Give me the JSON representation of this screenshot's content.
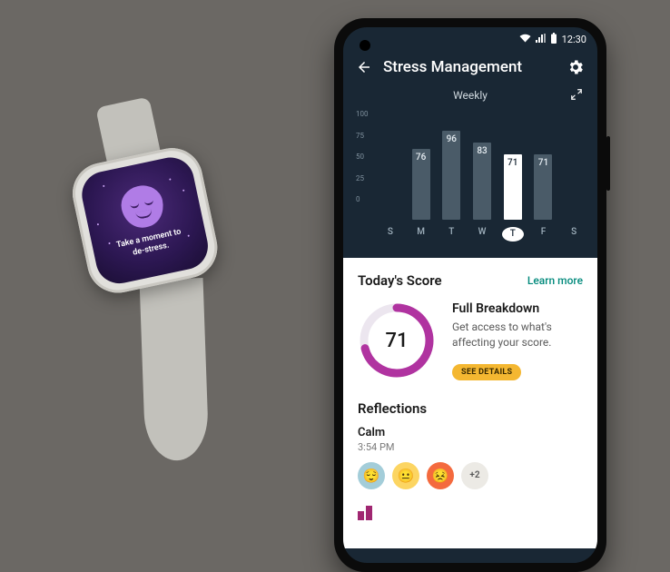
{
  "watch": {
    "message_line1": "Take a moment to",
    "message_line2": "de-stress."
  },
  "status": {
    "time": "12:30"
  },
  "appbar": {
    "title": "Stress Management"
  },
  "chart_data": {
    "type": "bar",
    "period_label": "Weekly",
    "categories": [
      "S",
      "M",
      "T",
      "W",
      "T",
      "F",
      "S"
    ],
    "values": [
      null,
      76,
      96,
      83,
      71,
      71,
      null,
      null
    ],
    "active_index": 4,
    "ylim": [
      0,
      100
    ],
    "yticks": [
      100,
      75,
      50,
      25,
      0
    ]
  },
  "today": {
    "heading": "Today's Score",
    "learn_more": "Learn more",
    "score": "71",
    "score_pct": 71,
    "breakdown_title": "Full Breakdown",
    "breakdown_body": "Get access to what's affecting your score.",
    "cta": "SEE DETAILS"
  },
  "reflections": {
    "heading": "Reflections",
    "mood_label": "Calm",
    "mood_time": "3:54 PM",
    "more_count": "+2"
  },
  "colors": {
    "accent": "#a02671",
    "ring": "#b033a0"
  }
}
